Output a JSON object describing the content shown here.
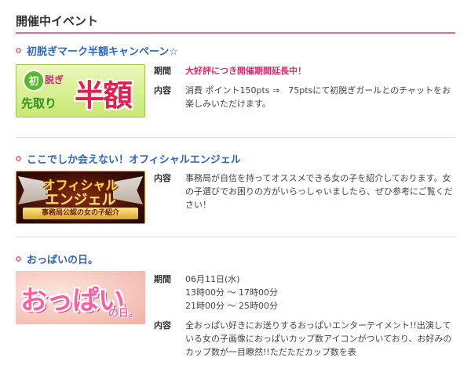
{
  "section": {
    "title": "開催中イベント"
  },
  "labels": {
    "period": "期間",
    "content": "内容"
  },
  "events": [
    {
      "title": "初脱ぎマーク半額キャンペーン☆",
      "banner": {
        "badge": "初",
        "line1": "脱ぎ",
        "line2": "先取り",
        "big": "半額"
      },
      "period": "大好評につき開催期間延長中！",
      "content": "消費 ポイント150pts ⇒　75ptsにて初脱ぎガールとのチャットをお楽しみいただけます。"
    },
    {
      "title": "ここでしか会えない！オフィシャルエンジェル",
      "banner": {
        "line1": "オフィシャル",
        "line2": "エンジェル",
        "band": "事務局公認の女の子紹介"
      },
      "content": "事務局が自信を持ってオススメできる女の子を紹介しております。女の子選びでお困りの方がいらっしゃいましたら、ぜひ参考にご覧ください！"
    },
    {
      "title": "おっぱいの日。",
      "banner": {
        "big": "おっぱい",
        "small": "の日。"
      },
      "period_lines": [
        "06月11日(水)",
        "13時00分 ～ 17時00分",
        "21時00分 ～ 25時00分"
      ],
      "content": "全おっぱい好きにお送りするおっぱいエンターテイメント!!出演している女の子画像におっぱいカップ数アイコンがついており、お好みのカップ数が一目瞭然!!ただただカップ数を表"
    }
  ],
  "colors": {
    "accent_pink": "#e06c92",
    "title_blue": "#2a67b8",
    "highlight": "#e0286a"
  }
}
